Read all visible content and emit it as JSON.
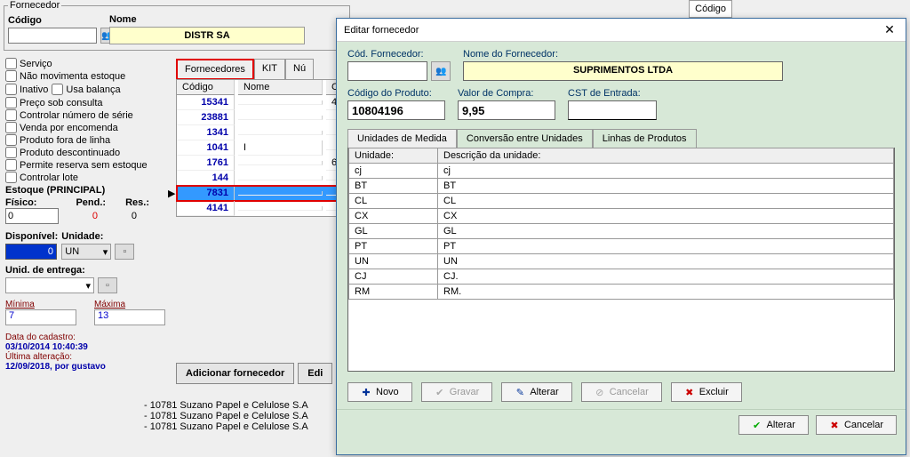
{
  "top_fieldset": {
    "legend": "Fornecedor",
    "codigo_label": "Código",
    "nome_label": "Nome",
    "nome_value": "DISTR SA"
  },
  "flags": {
    "servico": "Serviço",
    "nao_movimenta": "Não movimenta estoque",
    "inativo": "Inativo",
    "usa_balanca": "Usa balança",
    "preco_sob": "Preço sob consulta",
    "controlar_serie": "Controlar número de série",
    "venda_encomenda": "Venda por encomenda",
    "fora_linha": "Produto fora de linha",
    "descontinuado": "Produto descontinuado",
    "reserva_sem": "Permite reserva sem estoque",
    "controlar_lote": "Controlar lote"
  },
  "estoque": {
    "title": "Estoque (PRINCIPAL)",
    "fisico_label": "Físico:",
    "fisico_val": "0",
    "pend_label": "Pend.:",
    "pend_val": "0",
    "res_label": "Res.:",
    "res_val": "0",
    "disp_label": "Disponível:",
    "disp_val": "0",
    "unidade_label": "Unidade:",
    "unidade_val": "UN"
  },
  "entrega": {
    "title": "Unid. de entrega:",
    "min_label": "Mínima",
    "min_val": "7",
    "max_label": "Máxima",
    "max_val": "13"
  },
  "meta": {
    "cad_label": "Data do cadastro:",
    "cad_val": "03/10/2014 10:40:39",
    "alt_label": "Última alteração:",
    "alt_val": "12/09/2018, por gustavo"
  },
  "topright": {
    "title": "Código"
  },
  "mid": {
    "tabs": {
      "fornecedores": "Fornecedores",
      "kit": "KIT",
      "num": "Nú"
    },
    "cols": {
      "codigo": "Código",
      "nome": "Nome",
      "c": "C"
    },
    "rows": [
      {
        "codigo": "15341",
        "nome": "",
        "c": "4"
      },
      {
        "codigo": "23881",
        "nome": "",
        "c": ""
      },
      {
        "codigo": "1341",
        "nome": "",
        "c": ""
      },
      {
        "codigo": "1041",
        "nome": "I",
        "c": ""
      },
      {
        "codigo": "1761",
        "nome": "",
        "c": "6"
      },
      {
        "codigo": "144",
        "nome": "",
        "c": ""
      },
      {
        "codigo": "7831",
        "nome": "",
        "c": ""
      },
      {
        "codigo": "4141",
        "nome": "",
        "c": ""
      }
    ],
    "sel_index": 6,
    "add_btn": "Adicionar fornecedor",
    "edit_btn": "Edi"
  },
  "bottom": [
    "- 10781 Suzano Papel e Celulose S.A",
    "- 10781 Suzano Papel e Celulose S.A",
    "- 10781 Suzano Papel e Celulose S.A"
  ],
  "modal": {
    "title": "Editar fornecedor",
    "cod_label": "Cód. Fornecedor:",
    "nome_label": "Nome do Fornecedor:",
    "nome_val": "SUPRIMENTOS LTDA",
    "codprod_label": "Código do Produto:",
    "codprod_val": "10804196",
    "valor_label": "Valor de Compra:",
    "valor_val": "9,95",
    "cst_label": "CST de Entrada:",
    "cst_val": "",
    "tabs": {
      "um": "Unidades de Medida",
      "conv": "Conversão entre Unidades",
      "linhas": "Linhas de Produtos"
    },
    "um_cols": {
      "unidade": "Unidade:",
      "desc": "Descrição da unidade:"
    },
    "um_rows": [
      {
        "u": "cj",
        "d": "cj"
      },
      {
        "u": "BT",
        "d": "BT"
      },
      {
        "u": "CL",
        "d": "CL"
      },
      {
        "u": "CX",
        "d": "CX"
      },
      {
        "u": "GL",
        "d": "GL"
      },
      {
        "u": "PT",
        "d": "PT"
      },
      {
        "u": "UN",
        "d": "UN"
      },
      {
        "u": "CJ",
        "d": "CJ."
      },
      {
        "u": "RM",
        "d": "RM."
      }
    ],
    "btns": {
      "novo": "Novo",
      "gravar": "Gravar",
      "alterar": "Alterar",
      "cancelar": "Cancelar",
      "excluir": "Excluir"
    },
    "footer": {
      "alterar": "Alterar",
      "cancelar": "Cancelar"
    }
  }
}
